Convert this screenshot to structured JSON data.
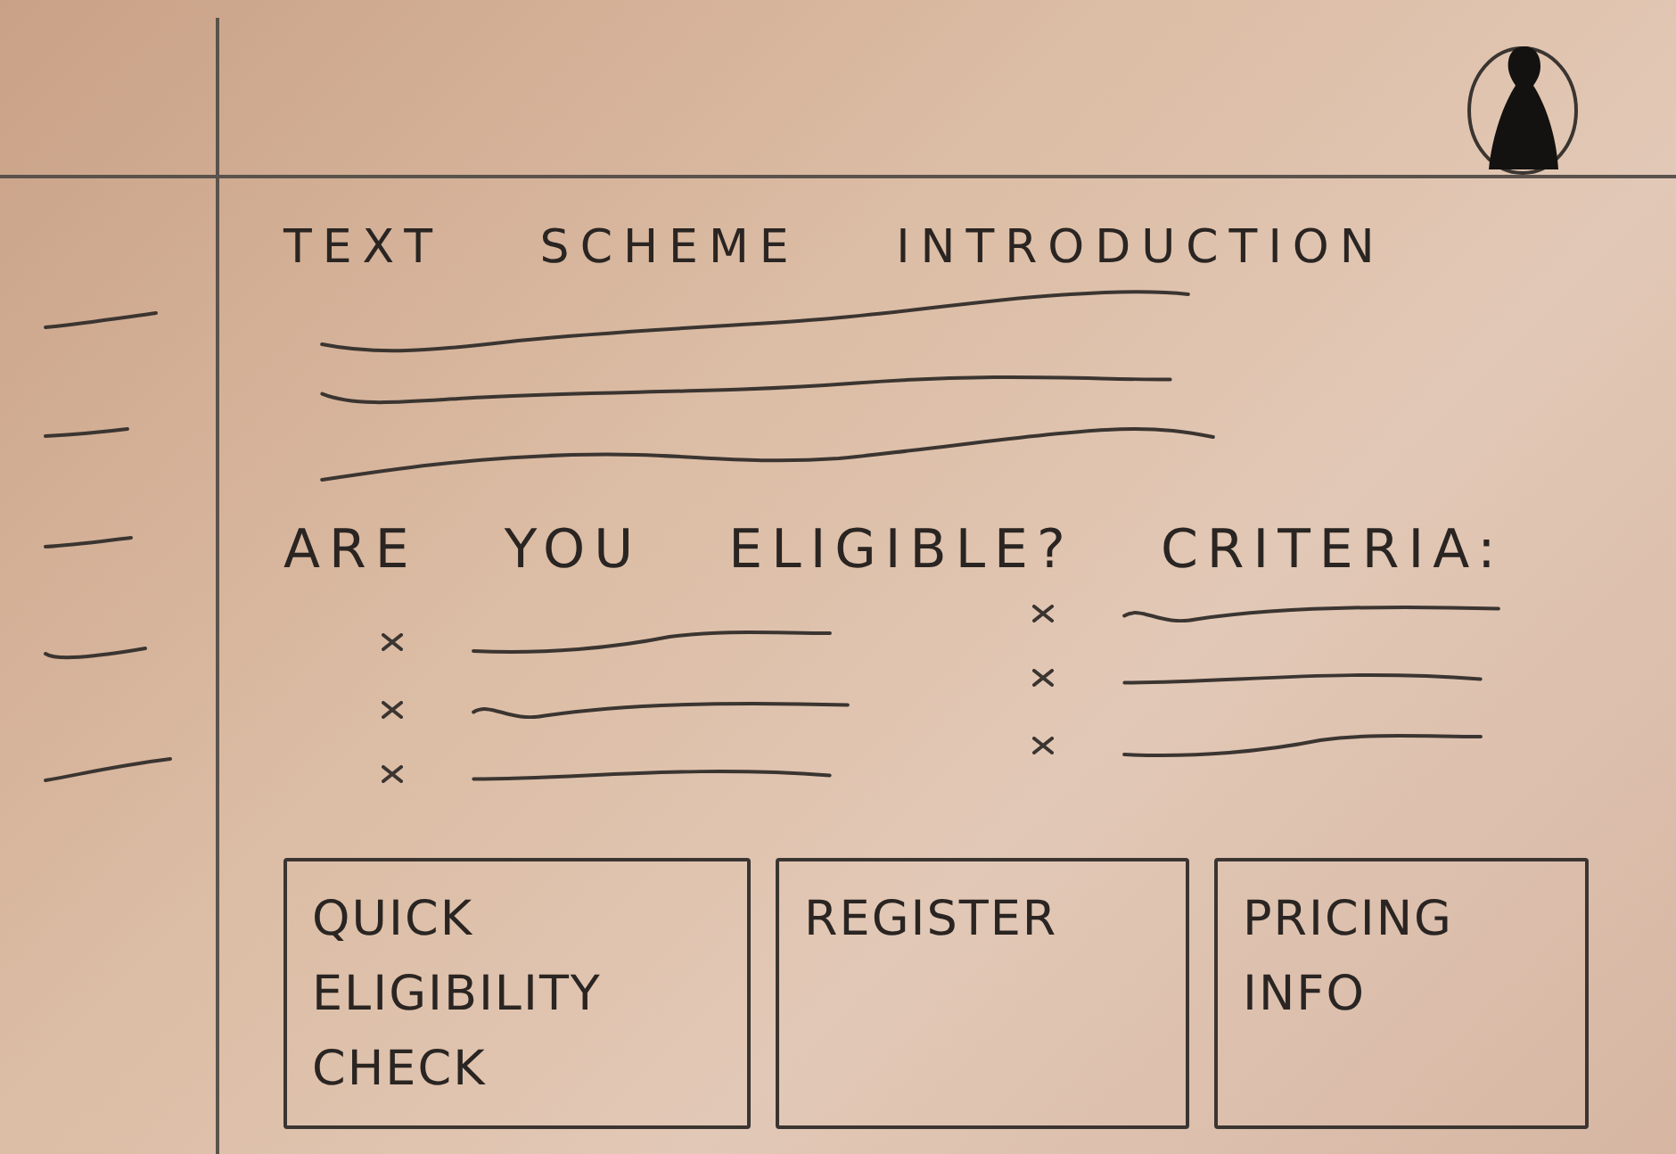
{
  "sidebar": {
    "items": [
      {
        "kind": "placeholder-line"
      },
      {
        "kind": "placeholder-line"
      },
      {
        "kind": "placeholder-line"
      },
      {
        "kind": "placeholder-line"
      },
      {
        "kind": "placeholder-line"
      }
    ]
  },
  "intro": {
    "heading": "TEXT SCHEME INTRODUCTION",
    "lines": [
      {
        "kind": "squiggle"
      },
      {
        "kind": "squiggle"
      },
      {
        "kind": "squiggle"
      }
    ]
  },
  "criteria": {
    "heading": "ARE YOU ELIGIBLE? CRITERIA:",
    "columns": [
      {
        "items": [
          {
            "kind": "bullet-line"
          },
          {
            "kind": "bullet-line"
          },
          {
            "kind": "bullet-line"
          }
        ]
      },
      {
        "items": [
          {
            "kind": "bullet-line"
          },
          {
            "kind": "bullet-line"
          },
          {
            "kind": "bullet-line"
          }
        ]
      }
    ]
  },
  "buttons": [
    {
      "label": "QUICK ELIGIBILITY CHECK"
    },
    {
      "label": "REGISTER"
    },
    {
      "label": "PRICING INFO"
    }
  ]
}
